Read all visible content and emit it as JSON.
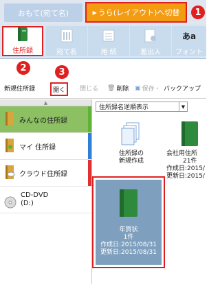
{
  "tabs": {
    "front": "おもて(宛て名)",
    "back": "うら(レイアウト)へ切替"
  },
  "callouts": [
    "1",
    "2",
    "3"
  ],
  "ribbon": {
    "items": [
      {
        "label": "住所録",
        "icon": "address-book-icon"
      },
      {
        "label": "宛て名",
        "icon": "address-label-icon"
      },
      {
        "label": "用 紙",
        "icon": "paper-icon"
      },
      {
        "label": "差出人",
        "icon": "sender-icon"
      },
      {
        "label": "フォント",
        "icon": "font-icon"
      }
    ],
    "font_icon_glyph": "あa"
  },
  "toolbar": {
    "new": "新規住所録",
    "open": "開く",
    "close": "閉じる",
    "delete": "削除",
    "save": "保存・",
    "backup": "バックアップ"
  },
  "sidebar": {
    "items": [
      {
        "label": "みんなの住所録",
        "bar": "green"
      },
      {
        "label": "マイ 住所録",
        "bar": "blue"
      },
      {
        "label": "クラウド住所録",
        "bar": "red"
      },
      {
        "label": "CD-DVD\n(D:)",
        "bar": ""
      }
    ]
  },
  "content": {
    "sort_label": "住所録名逆順表示",
    "new_card": {
      "line1": "住所録の",
      "line2": "新規作成"
    },
    "company_card": {
      "title": "会社用住所",
      "count": "21件",
      "created": "作成日:2015/",
      "updated": "更新日:2015/"
    },
    "selected_card": {
      "title": "年賀状",
      "count": "1件",
      "created": "作成日:2015/08/31",
      "updated": "更新日:2015/08/31"
    }
  },
  "colors": {
    "accent_orange": "#f39c12",
    "highlight_red": "#e02020",
    "selected_green": "#8cc063",
    "card_blue": "#7f9fbf"
  }
}
